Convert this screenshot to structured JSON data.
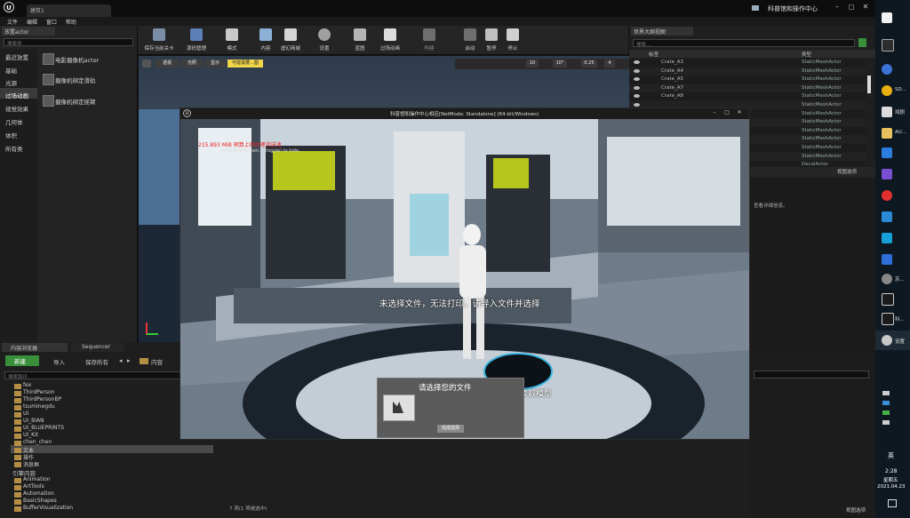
{
  "title_tab": "建筑1",
  "title_right": "科普馆和操作中心",
  "menu": [
    "文件",
    "编辑",
    "窗口",
    "帮助"
  ],
  "place_panel": {
    "tab": "放置actor",
    "search_placeholder": "搜索类",
    "categories": [
      "最近放置",
      "基础",
      "光源",
      "过场动画",
      "视觉效果",
      "几何体",
      "体积",
      "所有类"
    ],
    "selected_category": "过场动画",
    "items": [
      "电影摄像机actor",
      "摄像机绑定滑轨",
      "摄像机绑定摇臂"
    ]
  },
  "toolbar": [
    "保存当前关卡",
    "源码管理",
    "模式",
    "内容",
    "虚幻商城",
    "设置",
    "蓝图",
    "过场动画",
    "构建",
    "启动",
    "暂停",
    "停止"
  ],
  "viewport": {
    "perspective": "透视",
    "lit": "光照",
    "show": "显示",
    "warning": "可能需要...图",
    "snap_grid": "10",
    "snap_rot": "10°",
    "snap_scale": "0.25",
    "cam_speed": "4"
  },
  "game_window": {
    "title": "科普馆和操作中心相应[NetMode: Standalone] (64-bit/Windows)",
    "mem_warning": "215.893 MiB 预算上的纹理流送池",
    "disable_msg": "DisableAllScreen... (toggle) to hide...",
    "center_msg": "未选择文件，无法打印，请导入文件并选择",
    "partial_label": "读取模型",
    "dialog_title": "请选择您的文件",
    "dialog_button": "完成选择"
  },
  "outliner": {
    "tab": "世界大纲视图",
    "search_placeholder": "搜索...",
    "col_label": "标签",
    "col_type": "类型",
    "rows": [
      {
        "label": "Crate_A3",
        "type": "StaticMeshActor"
      },
      {
        "label": "Crate_A4",
        "type": "StaticMeshActor"
      },
      {
        "label": "Crate_A5",
        "type": "StaticMeshActor"
      },
      {
        "label": "Crate_A7",
        "type": "StaticMeshActor"
      },
      {
        "label": "Crate_A8",
        "type": "StaticMeshActor"
      },
      {
        "label": "",
        "type": "StaticMeshActor"
      },
      {
        "label": "",
        "type": "StaticMeshActor"
      },
      {
        "label": "",
        "type": "StaticMeshActor"
      },
      {
        "label": "",
        "type": "StaticMeshActor"
      },
      {
        "label": "",
        "type": "StaticMeshActor"
      },
      {
        "label": "",
        "type": "StaticMeshActor"
      },
      {
        "label": "",
        "type": "StaticMeshActor"
      },
      {
        "label": "",
        "type": "DecalActor"
      }
    ],
    "view_options": "视图选项"
  },
  "details": {
    "hint": "查看详细信息。",
    "view_options": "视图选项"
  },
  "content_browser": {
    "tab_content": "内容浏览器",
    "tab_sequencer": "Sequencer",
    "new_button": "新建",
    "import_button": "导入",
    "save_all_button": "保存所有",
    "path": "内容",
    "search_placeholder": "搜索路径",
    "folders": [
      "fex",
      "ThirdPerson",
      "ThirdPersonBP",
      "tsuminegdu",
      "UI",
      "UI_BIAN",
      "UI_BLUEPRINTS",
      "UI_Kit",
      "chen_chen",
      "文本",
      "操作",
      "消息框"
    ],
    "selected_folder": "文本",
    "engine_root": "引擎内容",
    "engine_folders": [
      "Animation",
      "ArtTools",
      "Automation",
      "BasicShapes",
      "BufferVisualization"
    ],
    "status": "7 项(1 项被选中)",
    "view_options": "视图选项"
  },
  "taskbar": {
    "apps": [
      "SD...",
      "戏剧",
      "AU...",
      "苏...",
      "科..."
    ],
    "settings": "设置",
    "time": "2:28",
    "day": "星期五",
    "date": "2021.04.23",
    "lang": "英"
  }
}
